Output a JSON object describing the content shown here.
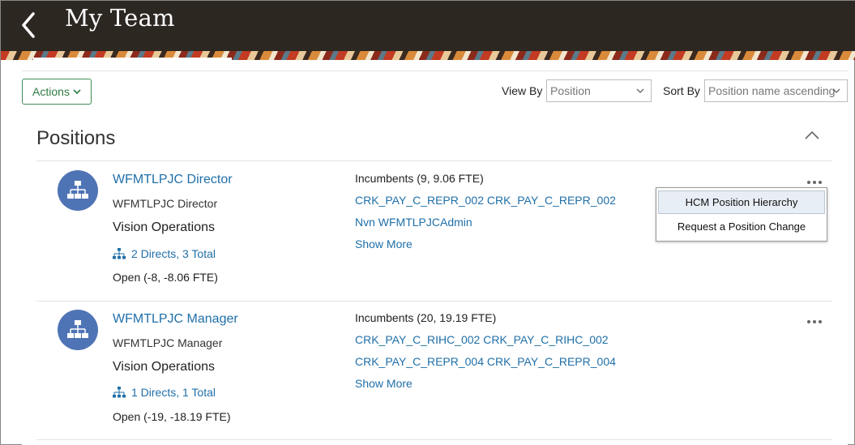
{
  "header": {
    "title": "My Team"
  },
  "toolbar": {
    "actions_label": "Actions",
    "view_by_label": "View By",
    "view_by_value": "Position",
    "sort_by_label": "Sort By",
    "sort_by_value": "Position name ascending"
  },
  "section": {
    "title": "Positions"
  },
  "positions": [
    {
      "name": "WFMTLPJC Director",
      "subtitle": "WFMTLPJC Director",
      "business_unit": "Vision Operations",
      "directs": "2 Directs, 3 Total",
      "open": "Open (-8, -8.06 FTE)",
      "incumbents_heading": "Incumbents (9, 9.06 FTE)",
      "incumbents": [
        "CRK_PAY_C_REPR_002 CRK_PAY_C_REPR_002",
        "Nvn WFMTLPJCAdmin"
      ],
      "show_more": "Show More"
    },
    {
      "name": "WFMTLPJC Manager",
      "subtitle": "WFMTLPJC Manager",
      "business_unit": "Vision Operations",
      "directs": "1 Directs, 1 Total",
      "open": "Open (-19, -18.19 FTE)",
      "incumbents_heading": "Incumbents (20, 19.19 FTE)",
      "incumbents": [
        "CRK_PAY_C_RIHC_002 CRK_PAY_C_RIHC_002",
        "CRK_PAY_C_REPR_004 CRK_PAY_C_REPR_004"
      ],
      "show_more": "Show More"
    }
  ],
  "context_menu": {
    "items": [
      "HCM Position Hierarchy",
      "Request a Position Change"
    ],
    "selected": "HCM Position Hierarchy"
  },
  "colors": {
    "header_bg": "#2d2722",
    "link": "#1f6fa8",
    "accent_green": "#2f7a45",
    "avatar": "#4f74b6"
  }
}
